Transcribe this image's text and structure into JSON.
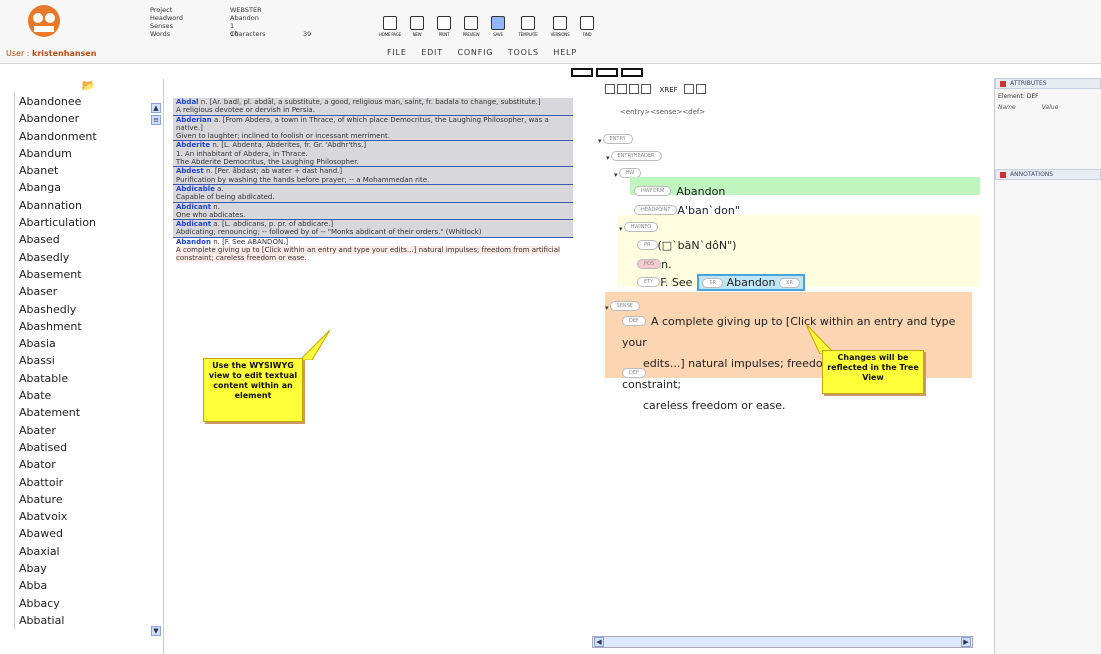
{
  "header": {
    "user_label": "User :",
    "user_name": "kristenhansen",
    "meta_left_labels": [
      "Project",
      "Headword",
      "Senses",
      "Words"
    ],
    "meta_left_values": [
      "WEBSTER",
      "Abandon",
      "1",
      "10"
    ],
    "characters_label": "Characters",
    "characters_value": "39",
    "toolbar": [
      "HOME PAGE",
      "NEW",
      "PRINT",
      "PREVIEW",
      "SAVE",
      "TEMPLATE",
      "VERSIONS",
      "FIND"
    ],
    "menu": [
      "FILE",
      "EDIT",
      "CONFIG",
      "TOOLS",
      "HELP"
    ]
  },
  "word_list": [
    "Abandonee",
    "Abandoner",
    "Abandonment",
    "Abandum",
    "Abanet",
    "Abanga",
    "Abannation",
    "Abarticulation",
    "Abased",
    "Abasedly",
    "Abasement",
    "Abaser",
    "Abashedly",
    "Abashment",
    "Abasia",
    "Abassi",
    "Abatable",
    "Abate",
    "Abatement",
    "Abater",
    "Abatised",
    "Abator",
    "Abattoir",
    "Abature",
    "Abatvoix",
    "Abawed",
    "Abaxial",
    "Abay",
    "Abba",
    "Abbacy",
    "Abbatial"
  ],
  "wysiwyg": [
    {
      "hw": "Abdal",
      "text": "n. [Ar. badl, pl. abdāl, a substitute, a good, religious man, saint, fr. badala to change, substitute.]",
      "def": "A religious devotee or dervish in Persia."
    },
    {
      "hw": "Abderian",
      "text": "a. [From Abdera, a town in Thrace, of which place Democritus, the Laughing Philosopher, was a native.]",
      "def": "Given to laughter; inclined to foolish or incessant merriment."
    },
    {
      "hw": "Abderite",
      "text": "n. [L. Abdenta, Abderites, fr. Gr. 'Abdhr'ths.]",
      "def": "1. An inhabitant of Abdera, in Thrace.",
      "def2": "The Abderite Democritus, the Laughing Philosopher."
    },
    {
      "hw": "Abdest",
      "text": "n. [Per. âbdast; ab water + dast hand.]",
      "def": "Purification by washing the hands before prayer; -- a Mohammedan rite."
    },
    {
      "hw": "Abdicable",
      "text": "a.",
      "def": "Capable of being abdicated."
    },
    {
      "hw": "Abdicant",
      "text": "n.",
      "def": "One who abdicates."
    },
    {
      "hw": "Abdicant",
      "text": "a. [L. abdicans, p. pr. of abdicare.]",
      "def": "Abdicating; renouncing; -- followed by of -- \"Monks abdicant of their orders.\" (Whitlock)"
    }
  ],
  "current_entry": {
    "hw": "Abandon",
    "text": "n. [F. See ABANDON.]",
    "def": "A complete giving up to [Click within an entry and type your edits...] natural impulses; freedom from artificial constraint; careless freedom or ease."
  },
  "callout_wysiwyg": "Use the WYSIWYG view to edit textual content within an element",
  "callout_tree": "Changes will be reflected in the Tree View",
  "tree": {
    "path": "<entry><sense><def>",
    "tools_label": "XREF",
    "tags": {
      "entry": "ENTRY",
      "entryheader": "ENTRYHEADER",
      "hw": "HW",
      "hwform": "HWFORM",
      "headpoint": "HEADPOINT",
      "hwinfo": "HWINFO",
      "pr": "PR",
      "pos": "POS",
      "ety": "ETY",
      "sr": "SR",
      "xr": "XR",
      "sense": "SENSE",
      "def": "DEF",
      "def2": "DEF"
    },
    "hwform": "Abandon",
    "headpoint": "A'ban`don\"",
    "pron": "(□`băN`dôN\")",
    "pos": "n.",
    "ety_prefix": "F. See",
    "ety_link": "Abandon",
    "def_line1": "A complete giving up to [Click within an entry and type your",
    "def_line2": "edits...] natural impulses; freedom from artificial constraint;",
    "def_line3": "careless freedom or ease."
  },
  "attributes": {
    "title": "ATTRIBUTES",
    "element_label": "Element: DEF",
    "name_label": "Name",
    "value_label": "Value"
  },
  "annotations": {
    "title": "ANNOTATIONS"
  }
}
